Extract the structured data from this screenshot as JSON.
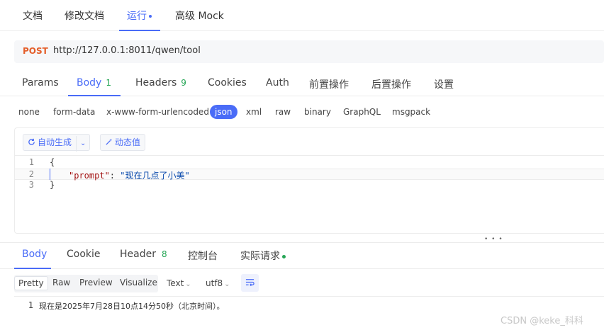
{
  "top_tabs": [
    {
      "label": "文档"
    },
    {
      "label": "修改文档"
    },
    {
      "label": "运行"
    },
    {
      "label": "高级 Mock"
    }
  ],
  "request": {
    "method": "POST",
    "url": "http://127.0.0.1:8011/qwen/tool"
  },
  "request_tabs": [
    {
      "label": "Params",
      "count": ""
    },
    {
      "label": "Body",
      "count": "1"
    },
    {
      "label": "Headers",
      "count": "9"
    },
    {
      "label": "Cookies",
      "count": ""
    },
    {
      "label": "Auth",
      "count": ""
    },
    {
      "label": "前置操作",
      "count": ""
    },
    {
      "label": "后置操作",
      "count": ""
    },
    {
      "label": "设置",
      "count": ""
    }
  ],
  "body_types": [
    "none",
    "form-data",
    "x-www-form-urlencoded",
    "json",
    "xml",
    "raw",
    "binary",
    "GraphQL",
    "msgpack"
  ],
  "selected_body_type": "json",
  "editor_toolbar": {
    "auto_generate": "自动生成",
    "dynamic_value": "动态值"
  },
  "body_code": {
    "line_numbers": [
      "1",
      "2",
      "3"
    ],
    "open_brace": "{",
    "key": "\"prompt\"",
    "colon": ": ",
    "value": "\"现在几点了小美\"",
    "close_brace": "}"
  },
  "divider_grip": "• • •",
  "response_tabs": [
    {
      "label": "Body",
      "count": ""
    },
    {
      "label": "Cookie",
      "count": ""
    },
    {
      "label": "Header",
      "count": "8"
    },
    {
      "label": "控制台",
      "count": ""
    },
    {
      "label": "实际请求",
      "count": ""
    }
  ],
  "view_modes": [
    "Pretty",
    "Raw",
    "Preview",
    "Visualize"
  ],
  "selected_view_mode": "Pretty",
  "format": "Text",
  "encoding": "utf8",
  "response_body": {
    "line_number": "1",
    "text": "现在是2025年7月28日10点14分50秒（北京时间）。"
  },
  "watermark": "CSDN @keke_科科",
  "colors": {
    "accent": "#4a6cf7",
    "method": "#e45e2a",
    "count_badge": "#26a656",
    "status_dot": "#26a656"
  }
}
